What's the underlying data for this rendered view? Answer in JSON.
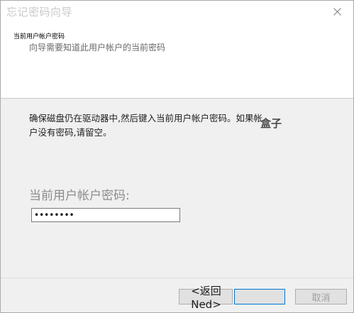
{
  "window": {
    "title": "忘记密码向导"
  },
  "header": {
    "heading": "当前用户帐户密码",
    "subheading": "向导需要知道此用户帐户的当前密码"
  },
  "content": {
    "instructions": "确保磁盘仍在驱动器中,然后键入当前用户帐户密码。如果帐户没有密码,请留空。",
    "watermark": "盒子",
    "password_label": "当前用户帐户密码:",
    "password_value": "••••••••"
  },
  "buttons": {
    "back_label": "<返回Ned>",
    "next_label": "",
    "cancel_label": "取消"
  },
  "icons": {
    "close": "close-icon"
  }
}
